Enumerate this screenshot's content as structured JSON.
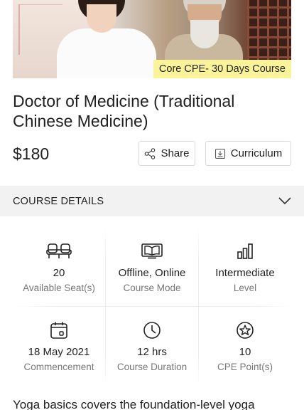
{
  "hero": {
    "badge": "Core CPE- 30 Days Course"
  },
  "course": {
    "title": "Doctor of Medicine (Traditional Chinese Medicine)",
    "price": "$180"
  },
  "actions": {
    "share_label": "Share",
    "curriculum_label": "Curriculum"
  },
  "details": {
    "heading": "COURSE DETAILS",
    "items": [
      {
        "icon": "seats-icon",
        "value": "20",
        "label": "Available Seat(s)"
      },
      {
        "icon": "book-icon",
        "value": "Offline, Online",
        "label": "Course Mode"
      },
      {
        "icon": "bar-chart-icon",
        "value": "Intermediate",
        "label": "Level"
      },
      {
        "icon": "calendar-icon",
        "value": "18 May 2021",
        "label": "Commencement"
      },
      {
        "icon": "clock-icon",
        "value": "12 hrs",
        "label": "Course Duration"
      },
      {
        "icon": "star-badge-icon",
        "value": "10",
        "label": "CPE Point(s)"
      }
    ]
  },
  "description": "Yoga basics covers the foundation-level yoga"
}
